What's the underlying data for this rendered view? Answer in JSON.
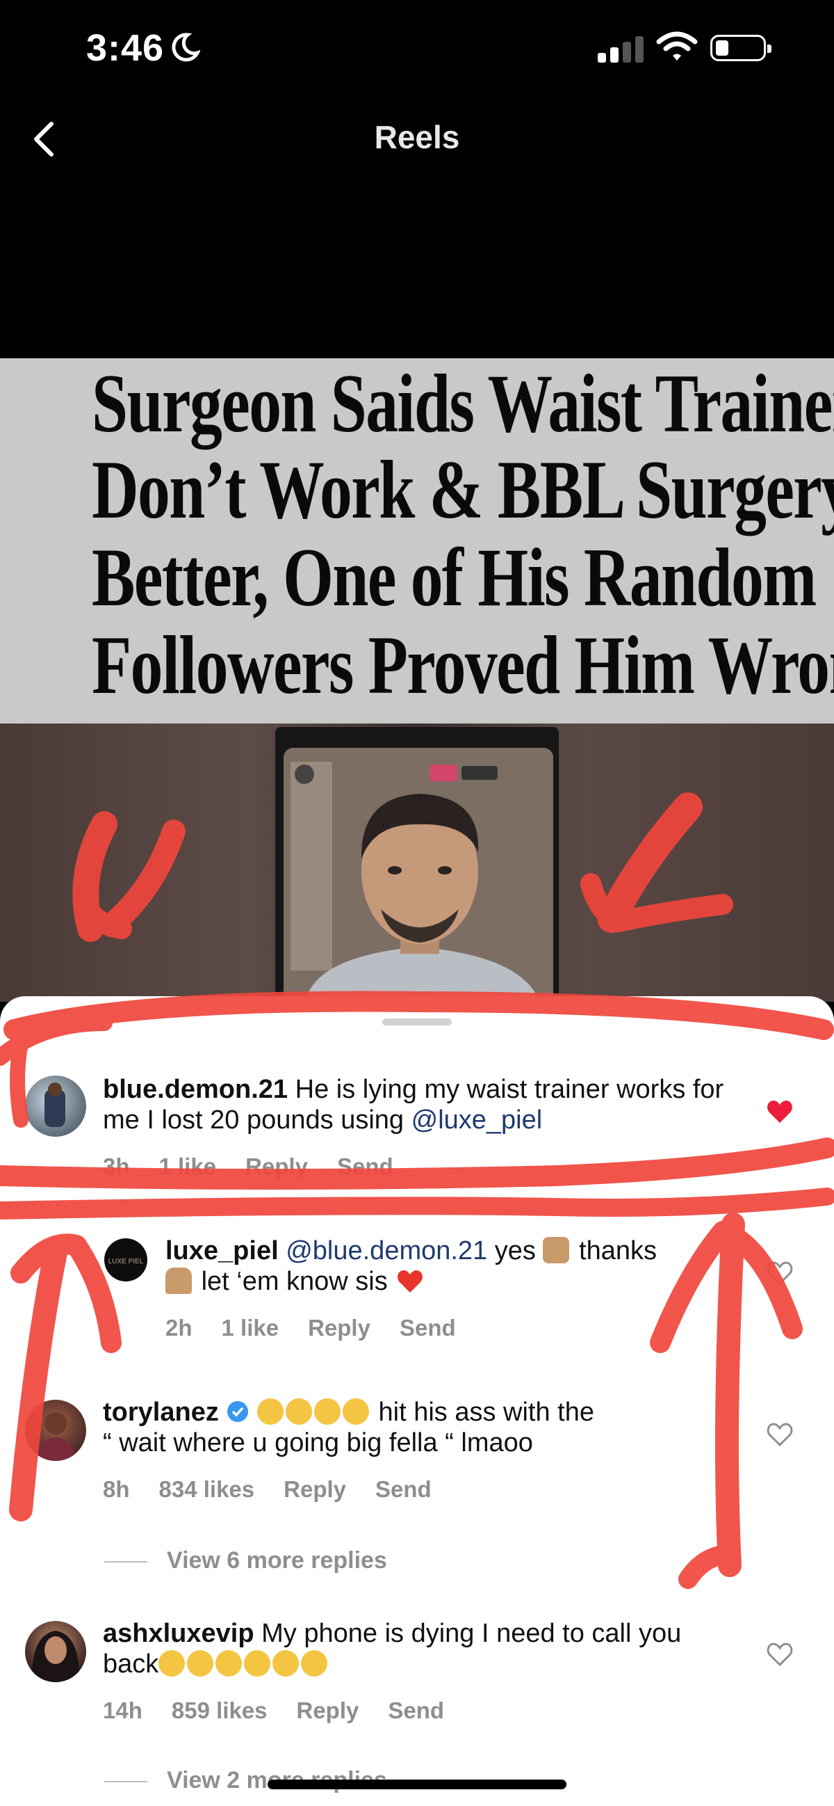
{
  "status_bar": {
    "time": "3:46"
  },
  "header": {
    "title": "Reels"
  },
  "video": {
    "caption_lines": [
      "Surgeon Saids Waist Trainers",
      "Don’t Work & BBL Surgery is",
      "Better, One of His Random",
      "Followers Proved Him Wrong"
    ]
  },
  "comments": [
    {
      "username": "blue.demon.21",
      "text": "He is lying my waist trainer works for me I lost 20 pounds using",
      "mention": "@luxe_piel",
      "time": "3h",
      "likes": "1 like",
      "reply": "Reply",
      "send": "Send",
      "liked": true
    },
    {
      "username": "luxe_piel",
      "mention": "@blue.demon.21",
      "text_line1": "yes",
      "text_line1b": "thanks",
      "text_line2": "let ‘em know sis",
      "time": "2h",
      "likes": "1 like",
      "reply": "Reply",
      "send": "Send",
      "liked": false
    },
    {
      "username": "torylanez",
      "verified": true,
      "text_line1": "hit his ass with the",
      "text_line2": "“ wait where u going big fella “ lmaoo",
      "time": "8h",
      "likes": "834 likes",
      "reply": "Reply",
      "send": "Send",
      "liked": false
    },
    {
      "username": "ashxluxevip",
      "text_line1": "My phone is dying I need to call you",
      "text_line2": "back",
      "time": "14h",
      "likes": "859 likes",
      "reply": "Reply",
      "send": "Send",
      "liked": false
    }
  ],
  "view_more": [
    "View 6 more replies",
    "View 2 more replies"
  ],
  "colors": {
    "annotation": "#f0463c",
    "liked_heart": "#ed1c3a",
    "mention": "#1e3a6e"
  },
  "icons": [
    "moon-icon",
    "cellular-signal-icon",
    "wifi-icon",
    "battery-icon",
    "back-chevron-icon",
    "heart-icon",
    "verified-badge-icon"
  ]
}
